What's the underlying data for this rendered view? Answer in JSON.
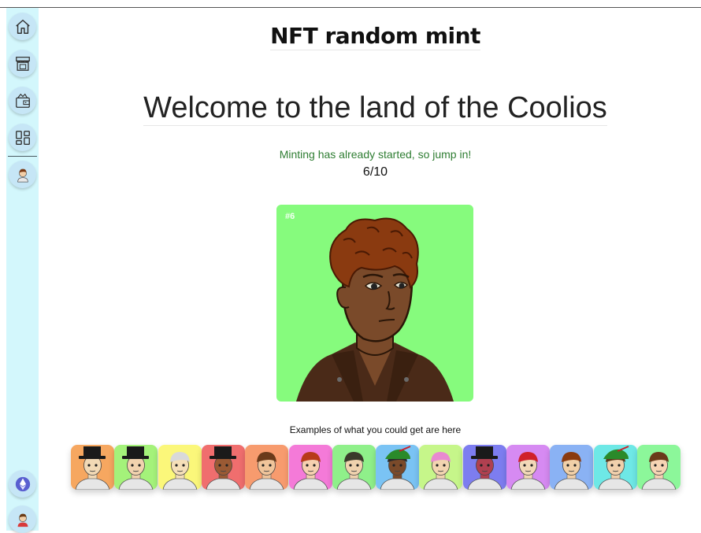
{
  "header": {
    "title": "NFT random mint"
  },
  "hero": {
    "heading": "Welcome to the land of the Coolios"
  },
  "mint": {
    "status": "Minting has already started, so jump in!",
    "progress": "6/10",
    "minted": 6,
    "total": 10
  },
  "current_nft": {
    "id_label": "#6",
    "background": "#86fb7d",
    "skin": "#7a4a2a",
    "hair": "#8a3a10"
  },
  "examples": {
    "label": "Examples of what you could get are here",
    "items": [
      {
        "bg": "#f6a760",
        "skin": "#f1d9b5",
        "hair": "#222222",
        "hat": "tophat"
      },
      {
        "bg": "#a4f27a",
        "skin": "#f1d2ae",
        "hair": "#5a3a1a",
        "hat": "tophat"
      },
      {
        "bg": "#fbf77a",
        "skin": "#f5dfb8",
        "hair": "#d9d9d9",
        "hat": "none"
      },
      {
        "bg": "#f06e6e",
        "skin": "#9a5a34",
        "hair": "#3a2a1a",
        "hat": "tophat"
      },
      {
        "bg": "#f79b6e",
        "skin": "#f0c49a",
        "hair": "#6a3a1a",
        "hat": "none"
      },
      {
        "bg": "#f47ad8",
        "skin": "#f6d0b0",
        "hair": "#b83a1a",
        "hat": "none"
      },
      {
        "bg": "#8ff08a",
        "skin": "#efd2ae",
        "hair": "#3a3a2a",
        "hat": "none"
      },
      {
        "bg": "#7ac3f4",
        "skin": "#7a4a2a",
        "hair": "#2a2a2a",
        "hat": "robin"
      },
      {
        "bg": "#c6f68a",
        "skin": "#f2d4b0",
        "hair": "#e88ad0",
        "hat": "none"
      },
      {
        "bg": "#7d7df0",
        "skin": "#b04050",
        "hair": "#e070c0",
        "hat": "tophat"
      },
      {
        "bg": "#d68af2",
        "skin": "#f2d8b8",
        "hair": "#d0202a",
        "hat": "mohawk"
      },
      {
        "bg": "#8ab2f4",
        "skin": "#f1d0a8",
        "hair": "#8a3a10",
        "hat": "none"
      },
      {
        "bg": "#6ee8e6",
        "skin": "#f0d0ac",
        "hair": "#5a3a1a",
        "hat": "robin"
      },
      {
        "bg": "#8cf79a",
        "skin": "#f6d4b4",
        "hair": "#6a3a1a",
        "hat": "none"
      }
    ]
  },
  "sidebar": {
    "items": [
      {
        "name": "home",
        "icon": "home-icon"
      },
      {
        "name": "store",
        "icon": "store-icon"
      },
      {
        "name": "wallet",
        "icon": "wallet-icon"
      },
      {
        "name": "dashboard",
        "icon": "dashboard-icon"
      },
      {
        "name": "profile",
        "icon": "avatar-icon"
      }
    ],
    "bottom": [
      {
        "name": "ethereum",
        "icon": "ethereum-icon"
      },
      {
        "name": "account",
        "icon": "avatar-icon"
      }
    ]
  }
}
